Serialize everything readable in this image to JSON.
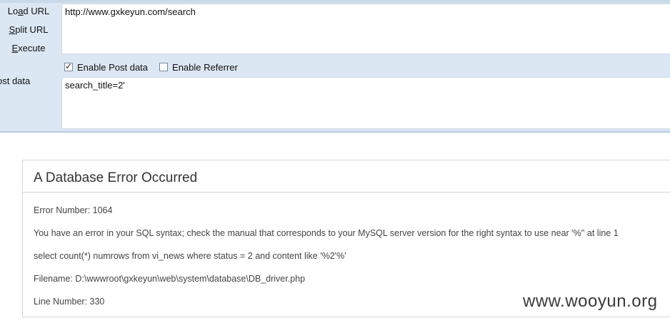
{
  "hackbar": {
    "buttons": [
      {
        "pre": "Lo",
        "key": "a",
        "post": "d URL"
      },
      {
        "pre": "",
        "key": "S",
        "post": "plit URL"
      },
      {
        "pre": "",
        "key": "E",
        "post": "xecute"
      }
    ],
    "url_value": "http://www.gxkeyun.com/search",
    "enable_post_label": "Enable Post data",
    "enable_post_checked": true,
    "enable_referrer_label": "Enable Referrer",
    "enable_referrer_checked": false,
    "post_data_label": "ost data",
    "post_data_value": "search_title=2'"
  },
  "error": {
    "title": "A Database Error Occurred",
    "lines": [
      "Error Number: 1064",
      "You have an error in your SQL syntax; check the manual that corresponds to your MySQL server version for the right syntax to use near '%'' at line 1",
      "select count(*) numrows from vi_news where status = 2 and content like '%2'%'",
      "Filename: D:\\wwwroot\\gxkeyun\\web\\system\\database\\DB_driver.php",
      "Line Number: 330"
    ]
  },
  "watermark": "www.wooyun.org",
  "colors": {
    "hackbar_bg": "#dbe7f3",
    "panel_border": "#d6d6d6"
  }
}
